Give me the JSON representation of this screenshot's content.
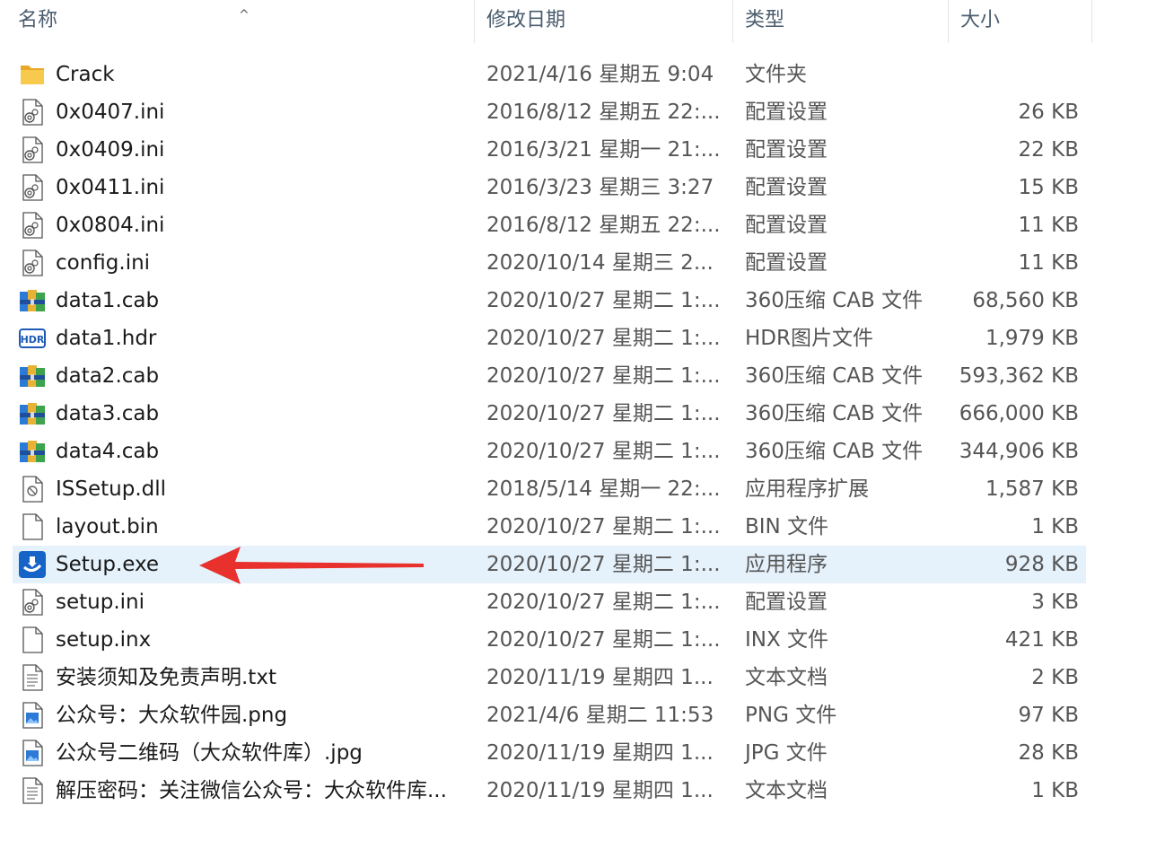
{
  "columns": {
    "name": "名称",
    "date": "修改日期",
    "type": "类型",
    "size": "大小"
  },
  "files": [
    {
      "name": "Crack",
      "date": "2021/4/16 星期五 9:04",
      "type": "文件夹",
      "size": "",
      "icon": "folder-icon"
    },
    {
      "name": "0x0407.ini",
      "date": "2016/8/12 星期五 22:...",
      "type": "配置设置",
      "size": "26 KB",
      "icon": "ini-config-icon"
    },
    {
      "name": "0x0409.ini",
      "date": "2016/3/21 星期一 21:...",
      "type": "配置设置",
      "size": "22 KB",
      "icon": "ini-config-icon"
    },
    {
      "name": "0x0411.ini",
      "date": "2016/3/23 星期三 3:27",
      "type": "配置设置",
      "size": "15 KB",
      "icon": "ini-config-icon"
    },
    {
      "name": "0x0804.ini",
      "date": "2016/8/12 星期五 22:...",
      "type": "配置设置",
      "size": "11 KB",
      "icon": "ini-config-icon"
    },
    {
      "name": "config.ini",
      "date": "2020/10/14 星期三 2...",
      "type": "配置设置",
      "size": "11 KB",
      "icon": "ini-config-icon"
    },
    {
      "name": "data1.cab",
      "date": "2020/10/27 星期二 1:...",
      "type": "360压缩 CAB 文件",
      "size": "68,560 KB",
      "icon": "archive-icon"
    },
    {
      "name": "data1.hdr",
      "date": "2020/10/27 星期二 1:...",
      "type": "HDR图片文件",
      "size": "1,979 KB",
      "icon": "hdr-icon"
    },
    {
      "name": "data2.cab",
      "date": "2020/10/27 星期二 1:...",
      "type": "360压缩 CAB 文件",
      "size": "593,362 KB",
      "icon": "archive-icon"
    },
    {
      "name": "data3.cab",
      "date": "2020/10/27 星期二 1:...",
      "type": "360压缩 CAB 文件",
      "size": "666,000 KB",
      "icon": "archive-icon"
    },
    {
      "name": "data4.cab",
      "date": "2020/10/27 星期二 1:...",
      "type": "360压缩 CAB 文件",
      "size": "344,906 KB",
      "icon": "archive-icon"
    },
    {
      "name": "ISSetup.dll",
      "date": "2018/5/14 星期一 22:...",
      "type": "应用程序扩展",
      "size": "1,587 KB",
      "icon": "dll-icon"
    },
    {
      "name": "layout.bin",
      "date": "2020/10/27 星期二 1:...",
      "type": "BIN 文件",
      "size": "1 KB",
      "icon": "blank-file-icon"
    },
    {
      "name": "Setup.exe",
      "date": "2020/10/27 星期二 1:...",
      "type": "应用程序",
      "size": "928 KB",
      "icon": "setup-exe-icon",
      "selected": true
    },
    {
      "name": "setup.ini",
      "date": "2020/10/27 星期二 1:...",
      "type": "配置设置",
      "size": "3 KB",
      "icon": "ini-config-icon"
    },
    {
      "name": "setup.inx",
      "date": "2020/10/27 星期二 1:...",
      "type": "INX 文件",
      "size": "421 KB",
      "icon": "blank-file-icon"
    },
    {
      "name": "安装须知及免责声明.txt",
      "date": "2020/11/19 星期四 1...",
      "type": "文本文档",
      "size": "2 KB",
      "icon": "text-file-icon"
    },
    {
      "name": "公众号：大众软件园.png",
      "date": "2021/4/6 星期二 11:53",
      "type": "PNG 文件",
      "size": "97 KB",
      "icon": "image-file-icon"
    },
    {
      "name": "公众号二维码（大众软件库）.jpg",
      "date": "2020/11/19 星期四 1...",
      "type": "JPG 文件",
      "size": "28 KB",
      "icon": "image-file-icon"
    },
    {
      "name": "解压密码：关注微信公众号：大众软件库...",
      "date": "2020/11/19 星期四 1...",
      "type": "文本文档",
      "size": "1 KB",
      "icon": "text-file-icon"
    }
  ],
  "colors": {
    "selection": "#e5f1fb",
    "arrow": "#e8312d",
    "folder": "#f5c542"
  }
}
